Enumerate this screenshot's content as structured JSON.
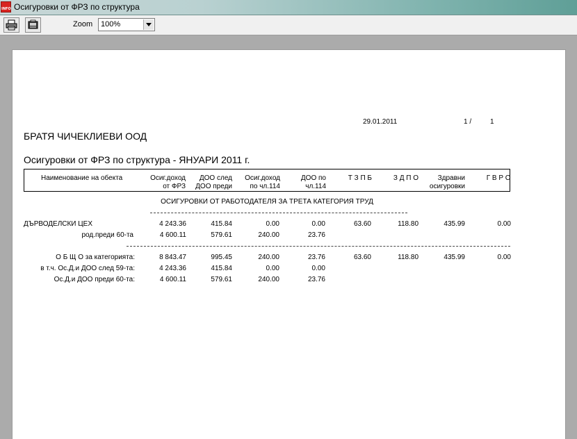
{
  "window": {
    "title": "Осигуровки от ФРЗ по структура",
    "icon_label": "INFO"
  },
  "toolbar": {
    "zoom_label": "Zoom",
    "zoom_value": "100%"
  },
  "report": {
    "date": "29.01.2011",
    "page_current": "1 /",
    "page_total": "1",
    "company": "БРАТЯ ЧИЧЕКЛИЕВИ ООД",
    "title": "Осигуровки от ФРЗ по структура - ЯНУАРИ 2011 г.",
    "headers": [
      {
        "l1": "Наименование на обекта",
        "l2": ""
      },
      {
        "l1": "Осиг.доход",
        "l2": "от ФРЗ"
      },
      {
        "l1": "ДОО след",
        "l2": "ДОО преди"
      },
      {
        "l1": "Осиг.доход",
        "l2": "по чл.114"
      },
      {
        "l1": "ДОО  по",
        "l2": "чл.114"
      },
      {
        "l1": "Т З П Б",
        "l2": ""
      },
      {
        "l1": "З Д П О",
        "l2": ""
      },
      {
        "l1": "Здравни",
        "l2": "осигуровки"
      },
      {
        "l1": "Г В Р С",
        "l2": ""
      }
    ],
    "section_title": "ОСИГУРОВКИ ОТ РАБОТОДАТЕЛЯ ЗА ТРЕТА КАТЕГОРИЯ ТРУД",
    "dept": {
      "name": "ДЪРВОДЕЛСКИ ЦЕХ",
      "row1": [
        "4 243.36",
        "415.84",
        "0.00",
        "0.00",
        "63.60",
        "118.80",
        "435.99",
        "0.00"
      ],
      "sub_label": "род.преди 60-та",
      "row2": [
        "4 600.11",
        "579.61",
        "240.00",
        "23.76"
      ]
    },
    "totals": {
      "label": "О Б Щ О  за категорията:",
      "row": [
        "8 843.47",
        "995.45",
        "240.00",
        "23.76",
        "63.60",
        "118.80",
        "435.99",
        "0.00"
      ],
      "sub1_label": "в т.ч. Ос.Д.и ДОО след 59-та:",
      "sub1": [
        "4 243.36",
        "415.84",
        "0.00",
        "0.00"
      ],
      "sub2_label": "Ос.Д.и ДОО преди 60-та:",
      "sub2": [
        "4 600.11",
        "579.61",
        "240.00",
        "23.76"
      ]
    }
  }
}
